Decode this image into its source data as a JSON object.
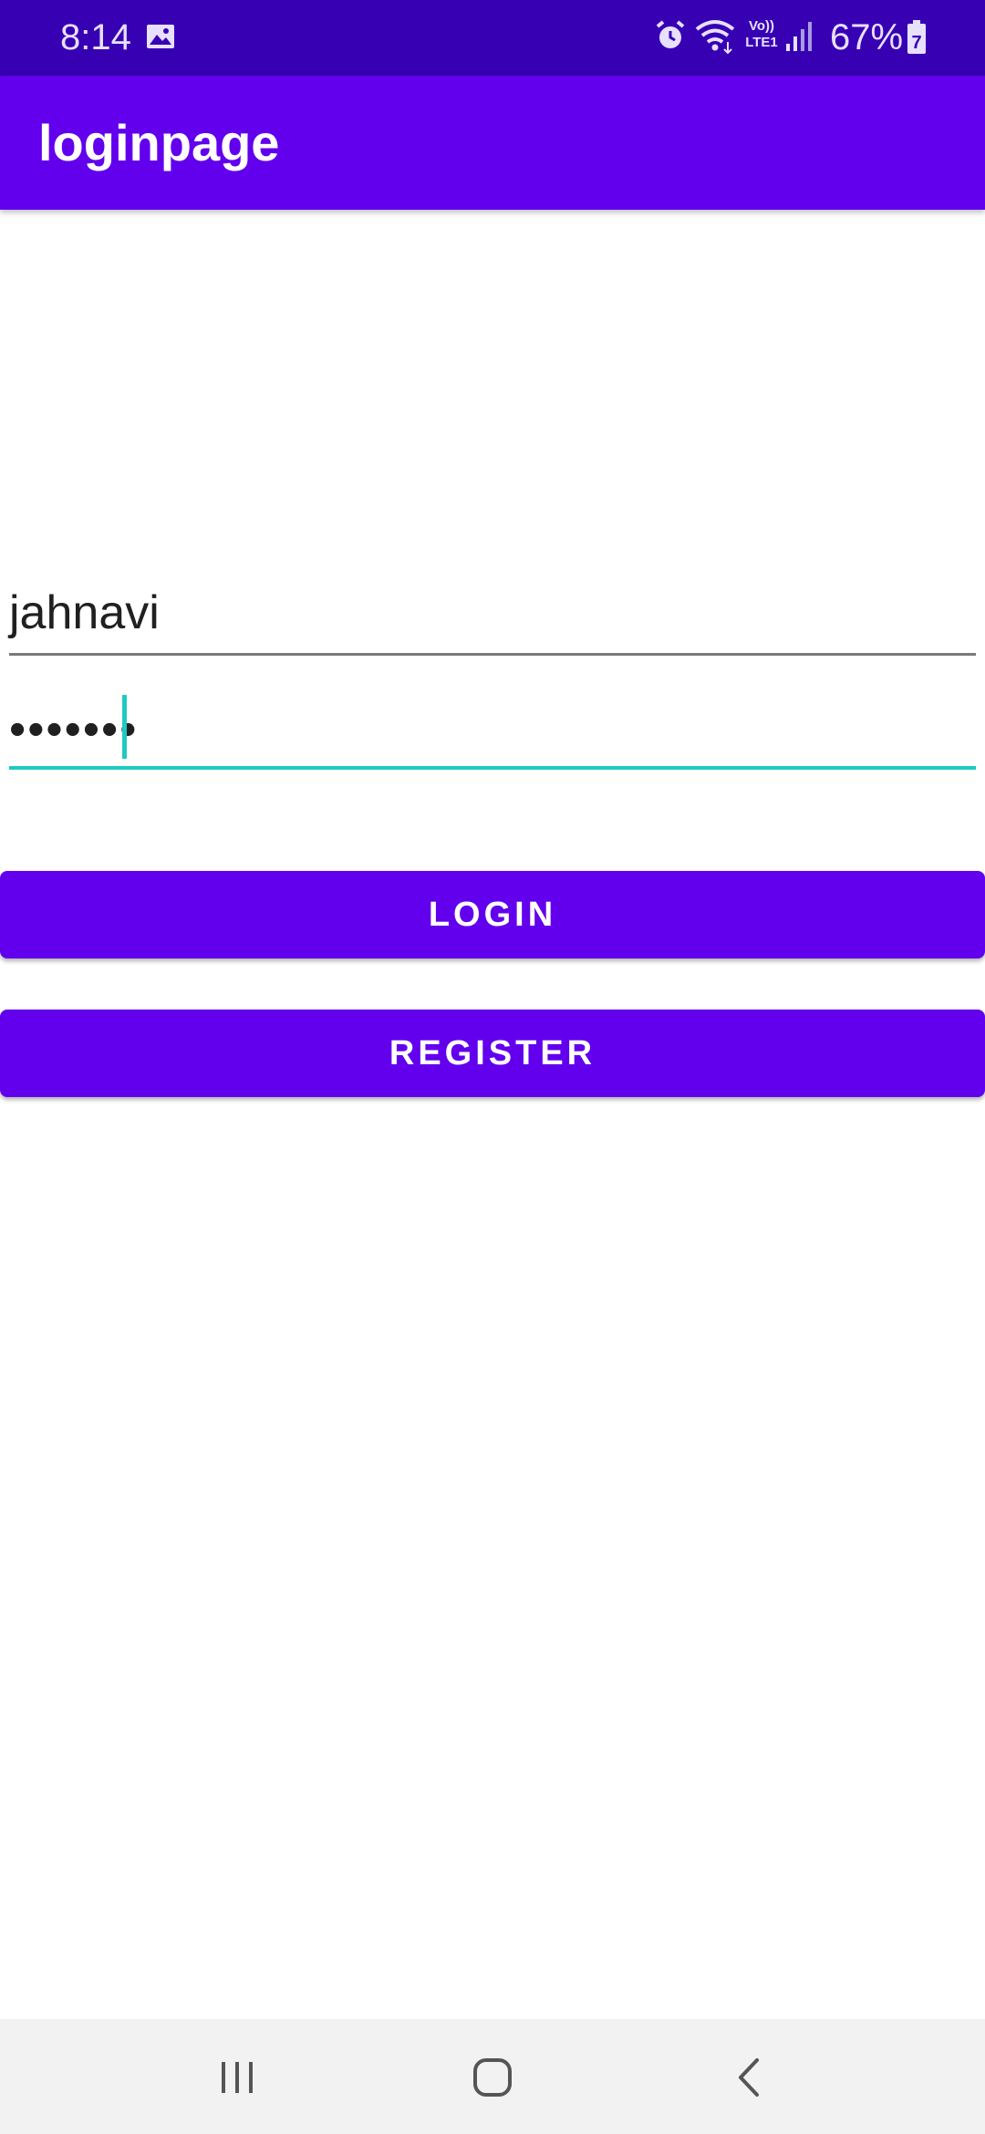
{
  "status_bar": {
    "time": "8:14",
    "battery_percent": "67%",
    "network_label_top": "Vo))",
    "network_label_bottom": "LTE1",
    "battery_level": "7",
    "icons": [
      "gallery-icon",
      "alarm-icon",
      "wifi-icon",
      "volte-lte-icon",
      "signal-icon",
      "battery-icon"
    ]
  },
  "app_bar": {
    "title": "loginpage"
  },
  "form": {
    "username_value": "jahnavi",
    "password_value": "•••••••"
  },
  "buttons": {
    "login_label": "LOGIN",
    "register_label": "REGISTER"
  },
  "nav_bar": {
    "icons": [
      "recents-icon",
      "home-icon",
      "back-icon"
    ]
  },
  "colors": {
    "status_bar": "#3700b3",
    "app_bar": "#6200ee",
    "button": "#6200ee",
    "focus_accent": "#1fc9c3",
    "nav_bar": "#f2f2f2"
  }
}
